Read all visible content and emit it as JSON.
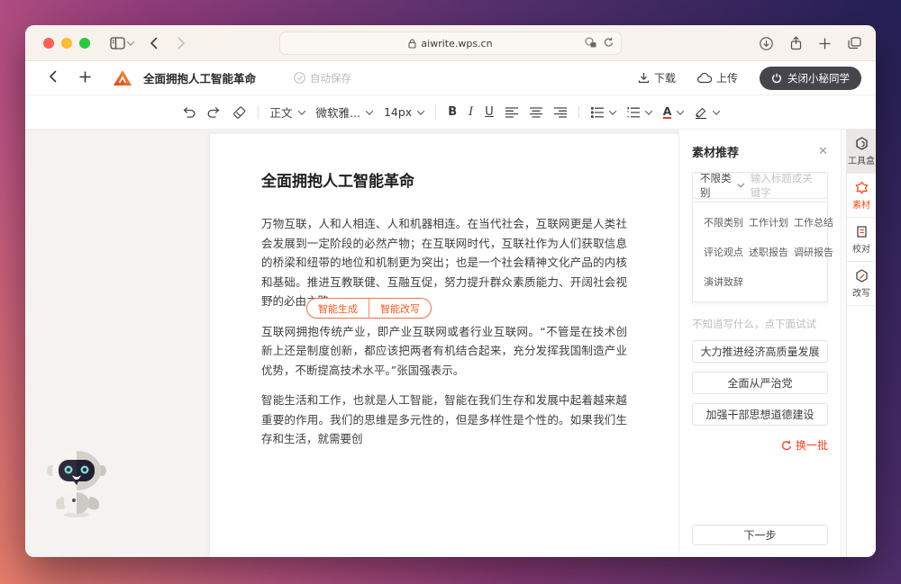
{
  "theme": {
    "accent_orange": "#ff4e14",
    "pill_orange": "#f25a22",
    "dark_button": "#46454c",
    "desktop_gradient": [
      "#e87f6b",
      "#923d7c",
      "#232055"
    ]
  },
  "browser": {
    "url": "aiwrite.wps.cn"
  },
  "appbar": {
    "doc_title": "全面拥抱人工智能革命",
    "autosave": "自动保存",
    "download": "下载",
    "upload": "上传",
    "close_assistant": "关闭小秘同学"
  },
  "fmtbar": {
    "style": "正文",
    "font": "微软雅...",
    "size": "14px",
    "bold": "B",
    "italic": "I",
    "underline": "U",
    "font_color": "A"
  },
  "document": {
    "title": "全面拥抱人工智能革命",
    "paragraphs": [
      "万物互联，人和人相连、人和机器相连。在当代社会，互联网更是人类社会发展到一定阶段的必然产物；在互联网时代，互联社作为人们获取信息的桥梁和纽带的地位和机制更为突出；也是一个社会精神文化产品的内核和基础。推进互教联健、互融互促，努力提升群众素质能力、开阔社会视野的必由之路。",
      "互联网拥抱传统产业，即产业互联网或者行业互联网。“不管是在技术创新上还是制度创新，都应该把两者有机结合起来，充分发挥我国制造产业优势，不断提高技术水平。”张国强表示。",
      "智能生活和工作，也就是人工智能，智能在我们生存和发展中起着越来越重要的作用。我们的思维是多元性的，但是多样性是个性的。如果我们生存和生活，就需要创"
    ],
    "ai_generate": "智能生成",
    "ai_rewrite": "智能改写"
  },
  "sidebar": {
    "title": "素材推荐",
    "filter": "不限类别",
    "search_placeholder": "输入标题或关键字",
    "categories": [
      "不限类别",
      "工作计划",
      "工作总结",
      "评论观点",
      "述职报告",
      "调研报告",
      "演讲致辞"
    ],
    "hint": "不知道写什么，点下面试试",
    "suggestions": [
      "大力推进经济高质量发展",
      "全面从严治党",
      "加强干部思想道德建设"
    ],
    "refresh": "换一批",
    "next": "下一步"
  },
  "rail": {
    "items": [
      {
        "label": "工具盒"
      },
      {
        "label": "素材"
      },
      {
        "label": "校对"
      },
      {
        "label": "改写"
      }
    ]
  }
}
